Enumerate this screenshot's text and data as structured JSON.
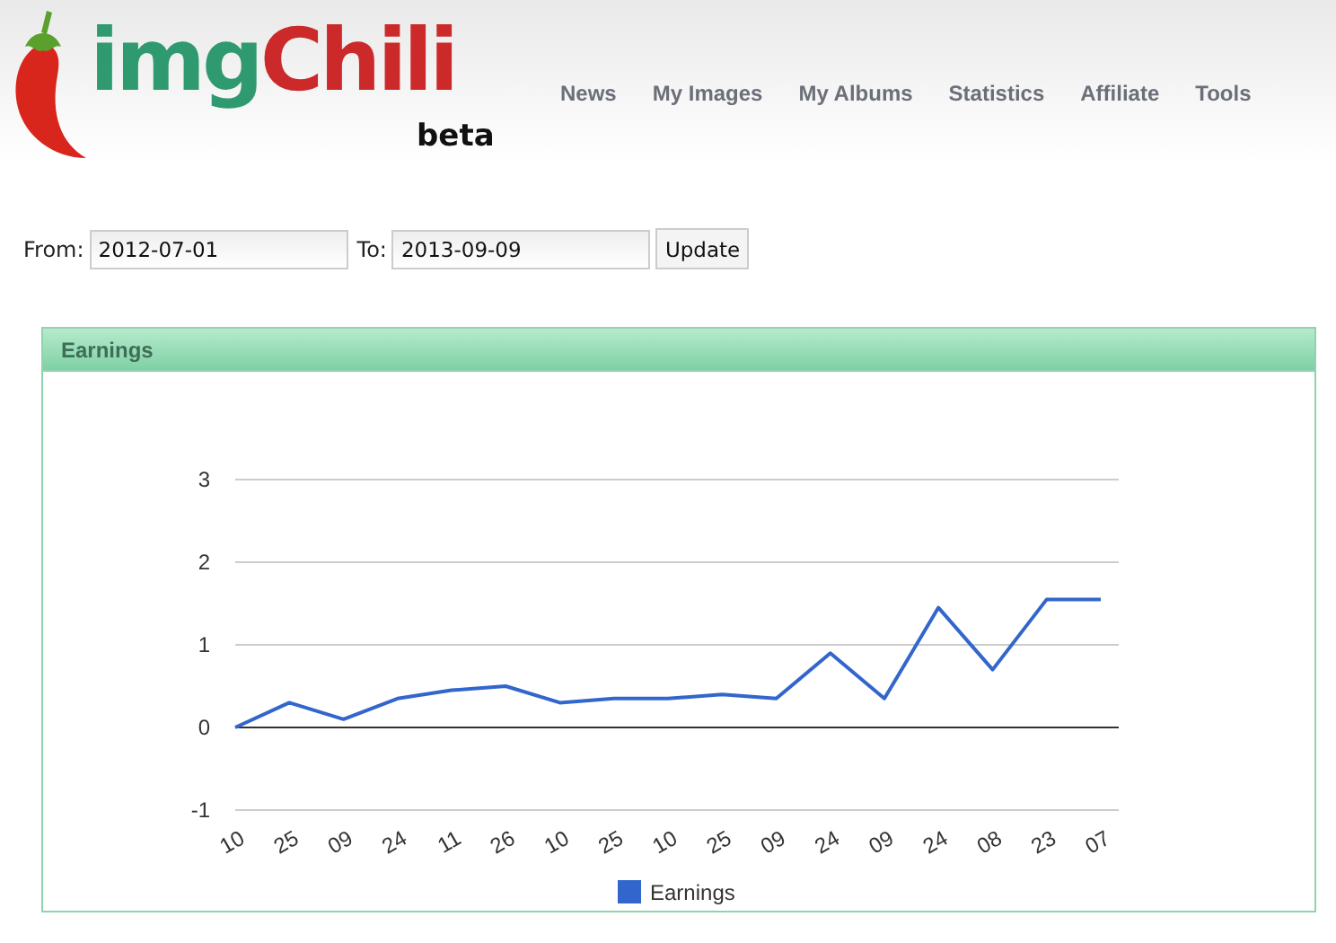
{
  "logo": {
    "name_part_1": "img",
    "name_part_2": "Chili",
    "tag": "beta"
  },
  "nav": [
    "News",
    "My Images",
    "My Albums",
    "Statistics",
    "Affiliate",
    "Tools"
  ],
  "filter": {
    "from_label": "From:",
    "from_value": "2012-07-01",
    "to_label": "To:",
    "to_value": "2013-09-09",
    "button": "Update"
  },
  "panel": {
    "title": "Earnings",
    "chart_data": {
      "type": "line",
      "ylim": [
        -1,
        3
      ],
      "yticks": [
        -1,
        0,
        1,
        2,
        3
      ],
      "categories": [
        "10",
        "25",
        "09",
        "24",
        "11",
        "26",
        "10",
        "25",
        "10",
        "25",
        "09",
        "24",
        "09",
        "24",
        "08",
        "23",
        "07"
      ],
      "series": [
        {
          "name": "Earnings",
          "color": "#3366cc",
          "values": [
            0,
            0.3,
            0.1,
            0.35,
            0.45,
            0.5,
            0.3,
            0.35,
            0.35,
            0.4,
            0.35,
            0.9,
            0.35,
            1.45,
            0.7,
            1.55,
            1.55
          ]
        }
      ]
    }
  }
}
